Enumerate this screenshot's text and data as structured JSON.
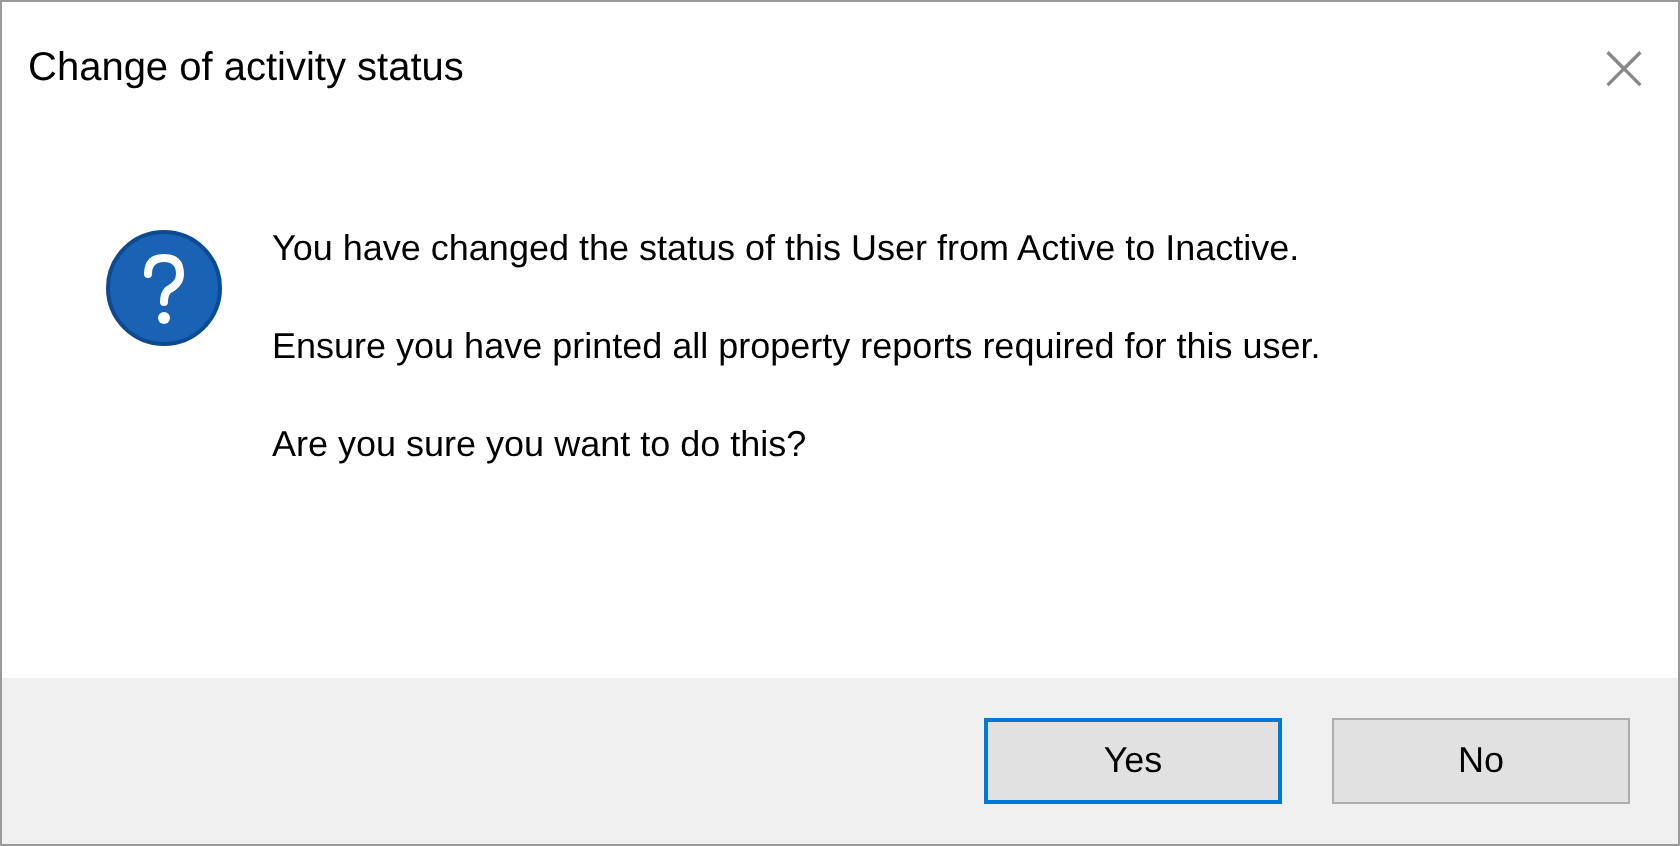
{
  "window": {
    "title": "Change of activity status",
    "close": "×"
  },
  "message": {
    "paragraphs": [
      "You have changed the status of this User from Active to Inactive.",
      "Ensure you have printed all property reports required for this user.",
      "Are you sure you want to do this?"
    ]
  },
  "buttons": [
    {
      "label": "Yes",
      "default": true
    },
    {
      "label": "No",
      "default": false
    }
  ]
}
